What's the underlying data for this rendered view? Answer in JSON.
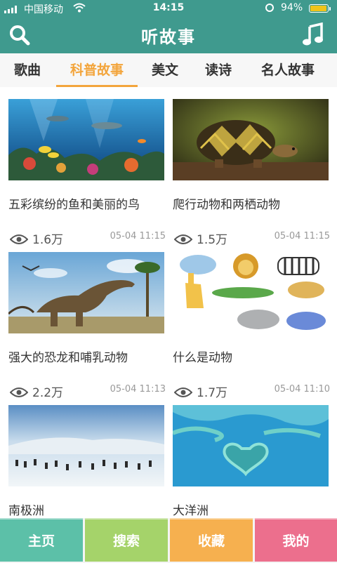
{
  "status": {
    "carrier": "中国移动",
    "time": "14:15",
    "battery": "94%",
    "battery_level": 0.94
  },
  "header": {
    "title": "听故事"
  },
  "tabs": [
    {
      "label": "歌曲"
    },
    {
      "label": "科普故事",
      "active": true
    },
    {
      "label": "美文"
    },
    {
      "label": "读诗"
    },
    {
      "label": "名人故事"
    }
  ],
  "cards": [
    {
      "title": "五彩缤纷的鱼和美丽的鸟",
      "views": "1.6万",
      "date": "05-04 11:15",
      "image": "coral-reef-fish"
    },
    {
      "title": "爬行动物和两栖动物",
      "views": "1.5万",
      "date": "05-04 11:15",
      "image": "tortoise"
    },
    {
      "title": "强大的恐龙和哺乳动物",
      "views": "2.2万",
      "date": "05-04 11:13",
      "image": "dinosaurs"
    },
    {
      "title": "什么是动物",
      "views": "1.7万",
      "date": "05-04 11:10",
      "image": "cartoon-animals"
    },
    {
      "title": "南极洲",
      "image": "antarctic-penguins"
    },
    {
      "title": "大洋洲",
      "image": "heart-reef"
    }
  ],
  "bottom_nav": [
    {
      "label": "主页",
      "color": "#5cc0a8"
    },
    {
      "label": "搜索",
      "color": "#a5d36a"
    },
    {
      "label": "收藏",
      "color": "#f6b04f"
    },
    {
      "label": "我的",
      "color": "#ec6f8d"
    }
  ],
  "colors": {
    "primary": "#3f9a8e",
    "accent": "#f3a53c"
  }
}
